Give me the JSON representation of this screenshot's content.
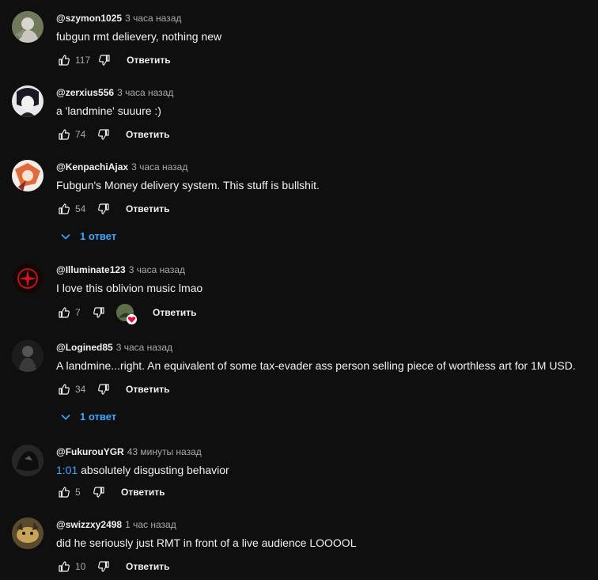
{
  "comments": [
    {
      "author": "@szymon1025",
      "time": "3 часа назад",
      "text": "fubgun rmt delievery, nothing new",
      "likes": "117",
      "reply_label": "Ответить",
      "avatar_icon": "bird-avatar"
    },
    {
      "author": "@zerxius556",
      "time": "3 часа назад",
      "text": "a 'landmine' suuure :)",
      "likes": "74",
      "reply_label": "Ответить",
      "avatar_icon": "anime-dark-avatar"
    },
    {
      "author": "@KenpachiAjax",
      "time": "3 часа назад",
      "text": "Fubgun's Money delivery system. This stuff is bullshit.",
      "likes": "54",
      "reply_label": "Ответить",
      "replies_label": "1 ответ",
      "avatar_icon": "anime-red-avatar"
    },
    {
      "author": "@Illuminate123",
      "time": "3 часа назад",
      "text": "I love this oblivion music lmao",
      "likes": "7",
      "reply_label": "Ответить",
      "hearted": true,
      "avatar_icon": "red-emblem-avatar"
    },
    {
      "author": "@Logined85",
      "time": "3 часа назад",
      "text": "A landmine...right. An equivalent of some tax-evader ass person selling piece of worthless art for 1M USD.",
      "likes": "34",
      "reply_label": "Ответить",
      "replies_label": "1 ответ",
      "avatar_icon": "dark-figure-avatar"
    },
    {
      "author": "@FukurouYGR",
      "time": "43 минуты назад",
      "timestamp_link": "1:01",
      "text": " absolutely disgusting behavior",
      "likes": "5",
      "reply_label": "Ответить",
      "avatar_icon": "dark-character-avatar"
    },
    {
      "author": "@swizzxy2498",
      "time": "1 час назад",
      "text": "did he seriously just RMT in front of a live audience LOOOOL",
      "likes": "10",
      "reply_label": "Ответить",
      "avatar_icon": "cat-avatar"
    }
  ],
  "colors": {
    "background": "#0f0f0f",
    "link": "#3ea6ff",
    "muted": "#aaaaaa",
    "heart": "#ff0033"
  }
}
